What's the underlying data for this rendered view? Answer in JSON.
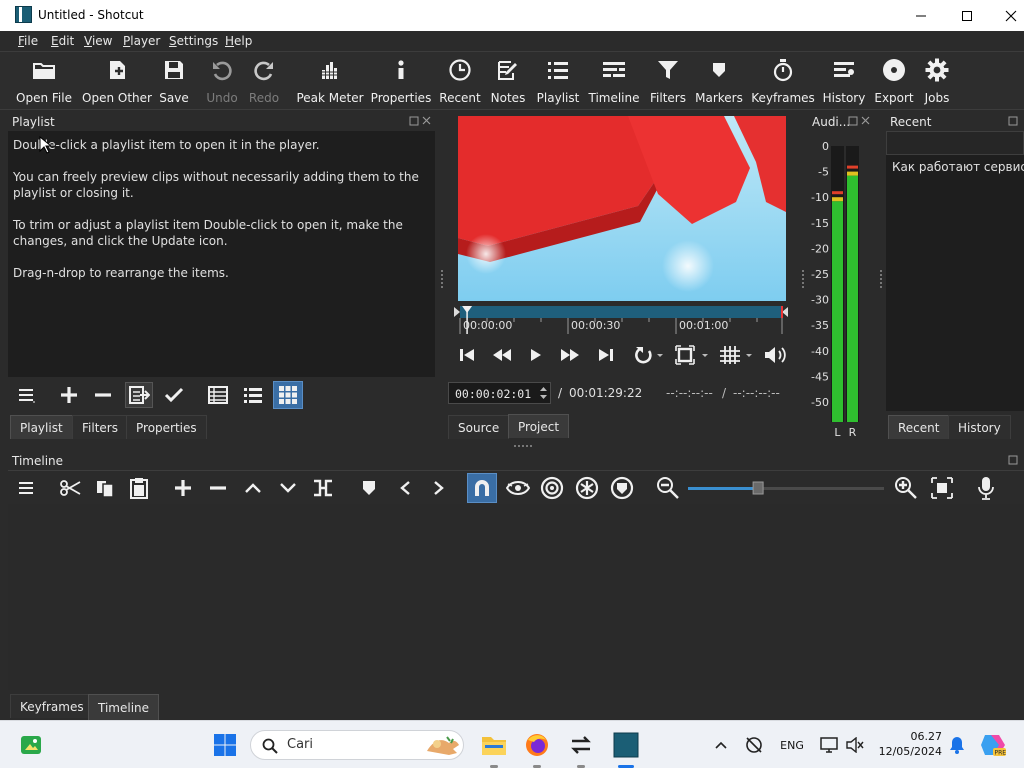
{
  "window": {
    "title": "Untitled - Shotcut"
  },
  "menu": [
    {
      "accel": "F",
      "rest": "ile"
    },
    {
      "accel": "E",
      "rest": "dit"
    },
    {
      "accel": "V",
      "rest": "iew"
    },
    {
      "accel": "P",
      "rest": "layer"
    },
    {
      "accel": "S",
      "rest": "ettings"
    },
    {
      "accel": "H",
      "rest": "elp"
    }
  ],
  "toolbar": {
    "open_file": "Open File",
    "open_other": "Open Other",
    "save": "Save",
    "undo": "Undo",
    "redo": "Redo",
    "peak_meter": "Peak Meter",
    "properties": "Properties",
    "recent": "Recent",
    "notes": "Notes",
    "playlist": "Playlist",
    "timeline": "Timeline",
    "filters": "Filters",
    "markers": "Markers",
    "keyframes": "Keyframes",
    "history": "History",
    "export": "Export",
    "jobs": "Jobs"
  },
  "playlist": {
    "title": "Playlist",
    "help": [
      {
        "pre": "",
        "b": "Double-click",
        "post": " a playlist item to open it in the player."
      },
      {
        "pre": "You can freely preview clips without necessarily adding them to the playlist or closing it.",
        "b": "",
        "post": ""
      },
      {
        "pre": "To trim or adjust a playlist item ",
        "b": "Double-click",
        "post": " to open it, make the changes, and click the ",
        "b2": "Update",
        "post2": " icon."
      },
      {
        "pre": "",
        "b": "Drag-n-drop",
        "post": " to rearrange the items."
      }
    ],
    "tabs": [
      "Playlist",
      "Filters",
      "Properties"
    ]
  },
  "player": {
    "ruler": [
      "00:00:00",
      "00:00:30",
      "00:01:00"
    ],
    "position": "00:00:02:01",
    "separator": "/",
    "duration": "00:01:29:22",
    "in_point": "--:--:--:--",
    "out_point": "--:--:--:--",
    "playhead_fraction": 0.022,
    "tabs": [
      "Source",
      "Project"
    ]
  },
  "audio": {
    "title": "Audi...",
    "scale": [
      "0",
      "-5",
      "-10",
      "-15",
      "-20",
      "-25",
      "-30",
      "-35",
      "-40",
      "-45",
      "-50"
    ],
    "channels": [
      "L",
      "R"
    ],
    "level_left_db": -10,
    "level_right_db": -5
  },
  "recent": {
    "title": "Recent",
    "item": "Как работают сервисн...",
    "tabs": [
      "Recent",
      "History"
    ]
  },
  "timeline": {
    "title": "Timeline",
    "tabs": [
      "Keyframes",
      "Timeline"
    ],
    "zoom_fraction": 0.35
  },
  "taskbar": {
    "search": "Cari",
    "lang": "ENG",
    "time": "06.27",
    "date": "12/05/2024"
  },
  "colors": {
    "accent_blue": "#3a6ea5",
    "meter_green": "#2fbf2f",
    "meter_yellow": "#e0c020",
    "meter_red": "#e0402a"
  }
}
